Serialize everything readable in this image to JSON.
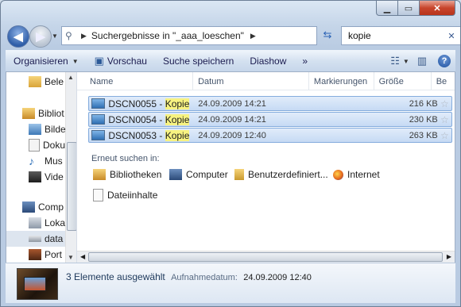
{
  "address": {
    "crumb": "Suchergebnisse in \"_aaa_loeschen\""
  },
  "search": {
    "value": "kopie"
  },
  "toolbar": {
    "organize": "Organisieren",
    "preview": "Vorschau",
    "save_search": "Suche speichern",
    "slideshow": "Diashow",
    "more": "»"
  },
  "nav": {
    "items": [
      {
        "label": "Bele"
      },
      {
        "label": "Bibliot"
      },
      {
        "label": "Bilde"
      },
      {
        "label": "Doku"
      },
      {
        "label": "Mus"
      },
      {
        "label": "Vide"
      },
      {
        "label": "Comp"
      },
      {
        "label": "Loka"
      },
      {
        "label": "data"
      },
      {
        "label": "Port"
      }
    ]
  },
  "columns": [
    "Name",
    "Datum",
    "Markierungen",
    "Größe",
    "Be"
  ],
  "rows": [
    {
      "name_a": "DSCN0055 - ",
      "name_b": "Kopie",
      "date": "24.09.2009 14:21",
      "size": "216 KB"
    },
    {
      "name_a": "DSCN0054 - ",
      "name_b": "Kopie",
      "date": "24.09.2009 14:21",
      "size": "230 KB"
    },
    {
      "name_a": "DSCN0053 - ",
      "name_b": "Kopie",
      "date": "24.09.2009 12:40",
      "size": "263 KB"
    }
  ],
  "search_again": {
    "title": "Erneut suchen in:",
    "items": [
      "Bibliotheken",
      "Computer",
      "Benutzerdefiniert...",
      "Internet",
      "Dateiinhalte"
    ]
  },
  "details": {
    "count": "3 Elemente ausgewählt",
    "date_label": "Aufnahmedatum:",
    "date_value": "24.09.2009 12:40"
  }
}
